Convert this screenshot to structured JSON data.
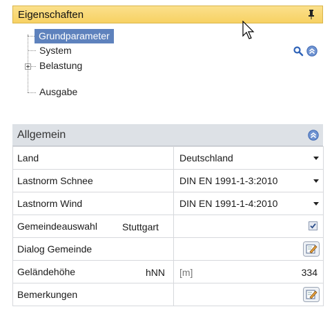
{
  "panel": {
    "title": "Eigenschaften",
    "pin_icon": "pin-icon"
  },
  "tree": {
    "items": [
      {
        "label": "Grundparameter",
        "selected": true
      },
      {
        "label": "System",
        "selected": false
      },
      {
        "label": "Belastung",
        "selected": false,
        "expandable": true
      },
      {
        "label": "Ausgabe",
        "selected": false
      }
    ],
    "search_icon": "search-icon",
    "collapse_icon": "collapse-up-icon"
  },
  "section": {
    "title": "Allgemein",
    "collapse_icon": "collapse-up-icon"
  },
  "properties": [
    {
      "label": "Land",
      "value": "Deutschland",
      "control": "dropdown"
    },
    {
      "label": "Lastnorm Schnee",
      "value": "DIN EN 1991-1-3:2010",
      "control": "dropdown"
    },
    {
      "label": "Lastnorm Wind",
      "value": "DIN EN 1991-1-4:2010",
      "control": "dropdown"
    },
    {
      "label": "Gemeindeauswahl",
      "sub": "Stuttgart",
      "value": "",
      "control": "checkbox",
      "checked": true
    },
    {
      "label": "Dialog Gemeinde",
      "value": "",
      "control": "edit-button"
    },
    {
      "label": "Geländehöhe",
      "sub": "hNN",
      "unit": "[m]",
      "value": "334",
      "control": "numeric"
    },
    {
      "label": "Bemerkungen",
      "value": "",
      "control": "edit-button"
    }
  ],
  "colors": {
    "title_bg": "#f7d163",
    "selection": "#5e82bd",
    "section_bg": "#dde1e6",
    "icon_blue": "#4a78c4"
  }
}
